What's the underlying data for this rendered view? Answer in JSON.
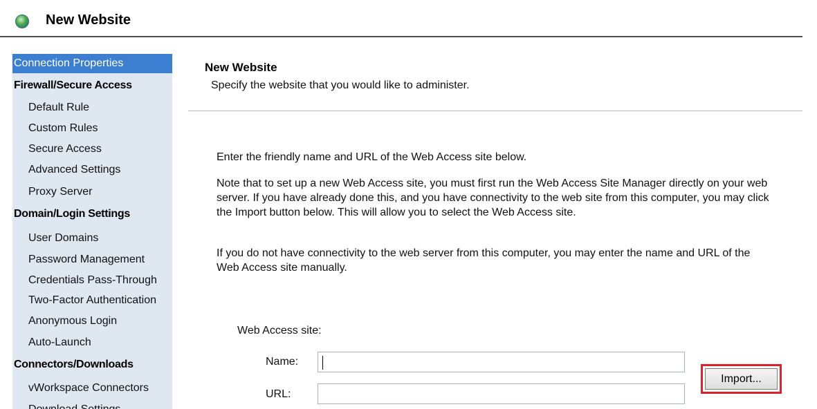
{
  "window": {
    "title": "New Website",
    "icon": "globe-icon"
  },
  "sidebar": {
    "items": [
      {
        "label": "Connection Properties",
        "kind": "selected"
      },
      {
        "label": "Firewall/Secure Access",
        "kind": "group"
      },
      {
        "label": "Default Rule",
        "kind": "sub"
      },
      {
        "label": "Custom Rules",
        "kind": "sub"
      },
      {
        "label": "Secure Access",
        "kind": "sub"
      },
      {
        "label": "Advanced Settings",
        "kind": "sub"
      },
      {
        "label": "Proxy Server",
        "kind": "sub"
      },
      {
        "label": "Domain/Login Settings",
        "kind": "group"
      },
      {
        "label": "User Domains",
        "kind": "sub"
      },
      {
        "label": "Password Management",
        "kind": "sub"
      },
      {
        "label": "Credentials Pass-Through",
        "kind": "sub"
      },
      {
        "label": "Two-Factor Authentication",
        "kind": "sub"
      },
      {
        "label": "Anonymous Login",
        "kind": "sub"
      },
      {
        "label": "Auto-Launch",
        "kind": "sub"
      },
      {
        "label": "Connectors/Downloads",
        "kind": "group"
      },
      {
        "label": "vWorkspace Connectors",
        "kind": "sub"
      },
      {
        "label": "Download Settings",
        "kind": "sub"
      }
    ]
  },
  "main": {
    "header": {
      "title": "New Website",
      "description": "Specify the website that you would like to administer."
    },
    "intro": "Enter the friendly name and URL of the Web Access site below.",
    "note_lines": [
      "Note that to set up a new Web Access site, you must first run the Web Access Site Manager directly on your web",
      "server. If you have already done this, and you have connectivity to the web site from this computer, you may click",
      "the Import button below. This will allow you to select the Web Access site."
    ],
    "manual_lines": [
      "If you do not have connectivity to the web server from this computer, you may enter the name and URL of the",
      "Web Access site manually."
    ],
    "form": {
      "section_label": "Web Access site:",
      "name_label": "Name:",
      "name_value": "",
      "url_label": "URL:",
      "url_value": "",
      "import_label": "Import..."
    }
  },
  "colors": {
    "sidebar_bg": "#dfe7f1",
    "selected_bg": "#3c7fd1",
    "highlight": "#e0202a"
  }
}
